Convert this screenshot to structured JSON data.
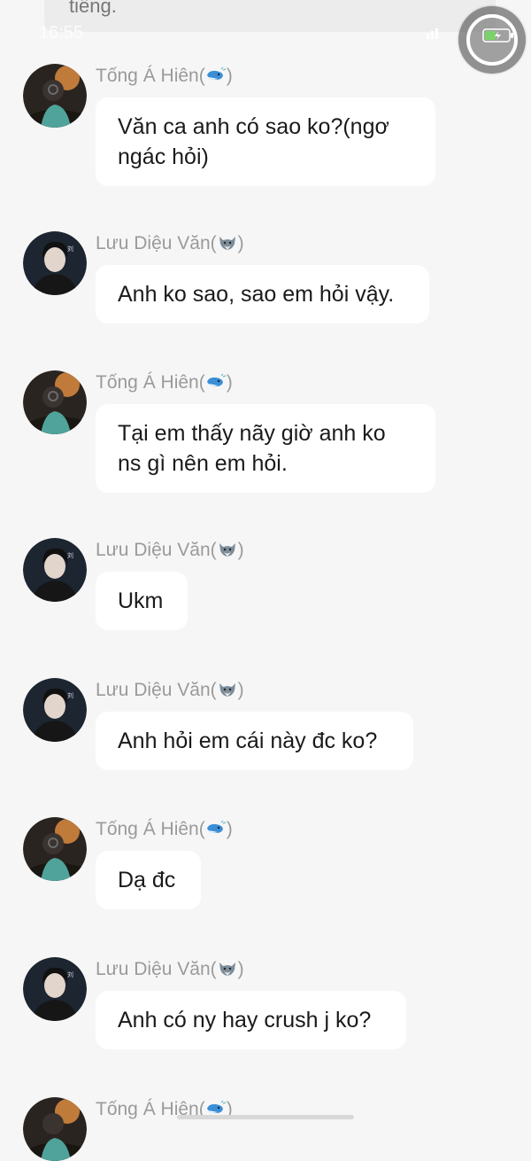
{
  "status_bar": {
    "time": "16:55",
    "top_overlay_text": "tiếng."
  },
  "senders": {
    "a": {
      "name": "Tống Á Hiên(",
      "close": ")",
      "emoji_icon": "whale-icon"
    },
    "b": {
      "name": "Lưu Diệu Văn(",
      "close": ")",
      "emoji_icon": "wolf-icon"
    }
  },
  "messages": [
    {
      "sender": "a",
      "text": "Văn ca anh có sao ko?(ngơ ngác hỏi)"
    },
    {
      "sender": "b",
      "text": "Anh ko sao, sao em hỏi vậy."
    },
    {
      "sender": "a",
      "text": "Tại em thấy nãy giờ anh ko ns gì nên em hỏi."
    },
    {
      "sender": "b",
      "text": "Ukm"
    },
    {
      "sender": "b",
      "text": "Anh hỏi em cái này đc ko?"
    },
    {
      "sender": "a",
      "text": "Dạ đc"
    },
    {
      "sender": "b",
      "text": "Anh có ny hay crush j ko?"
    },
    {
      "sender": "a",
      "text": ""
    }
  ],
  "colors": {
    "background": "#f6f6f6",
    "bubble": "#ffffff",
    "sender_name": "#9a9a9a",
    "message_text": "#1a1a1a"
  }
}
